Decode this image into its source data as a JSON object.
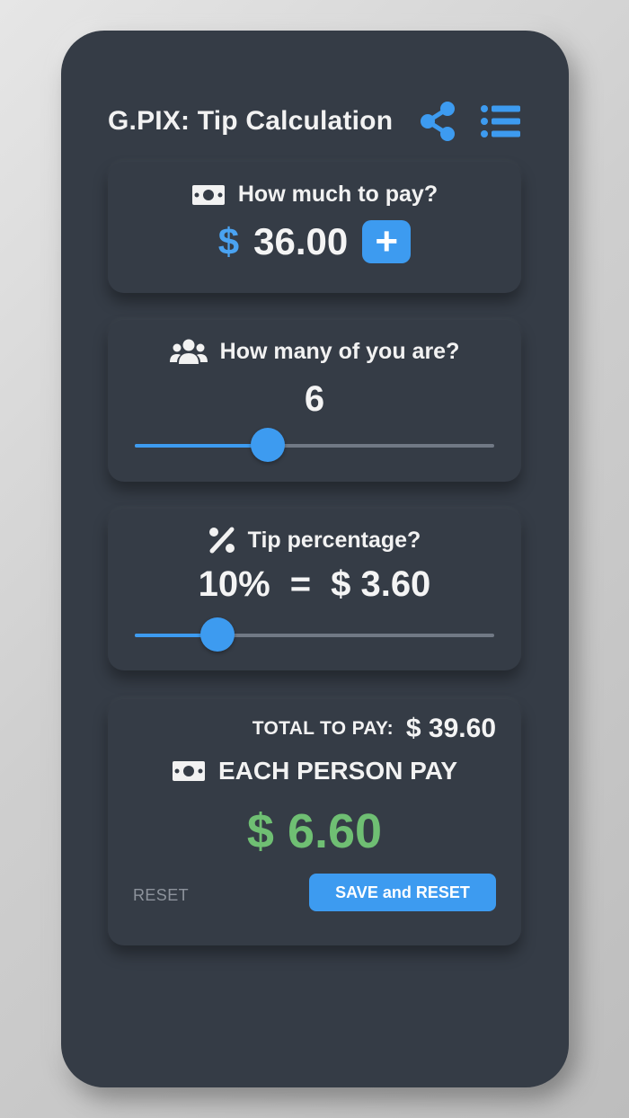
{
  "header": {
    "title": "G.PIX: Tip Calculation",
    "share_icon": "share-icon",
    "menu_icon": "list-menu-icon"
  },
  "amount_card": {
    "question": "How much to pay?",
    "icon": "money-bill-icon",
    "currency": "$",
    "amount": "36.00",
    "add_label": "+"
  },
  "people_card": {
    "question": "How many of you are?",
    "icon": "users-icon",
    "count": "6",
    "slider_fraction": 0.37
  },
  "tip_card": {
    "question": "Tip percentage?",
    "icon": "percent-icon",
    "percent": "10%",
    "equals": "=",
    "tip_amount": "$ 3.60",
    "slider_fraction": 0.23
  },
  "result_card": {
    "total_label": "TOTAL TO PAY:",
    "total_value": "$ 39.60",
    "each_label": "EACH PERSON PAY",
    "each_icon": "money-bill-icon",
    "each_value": "$ 6.60",
    "reset_label": "RESET",
    "save_label": "SAVE and RESET"
  },
  "colors": {
    "background": "#353c46",
    "accent": "#3d9bf0",
    "positive": "#6fbf73",
    "text": "#f2f2f2"
  }
}
